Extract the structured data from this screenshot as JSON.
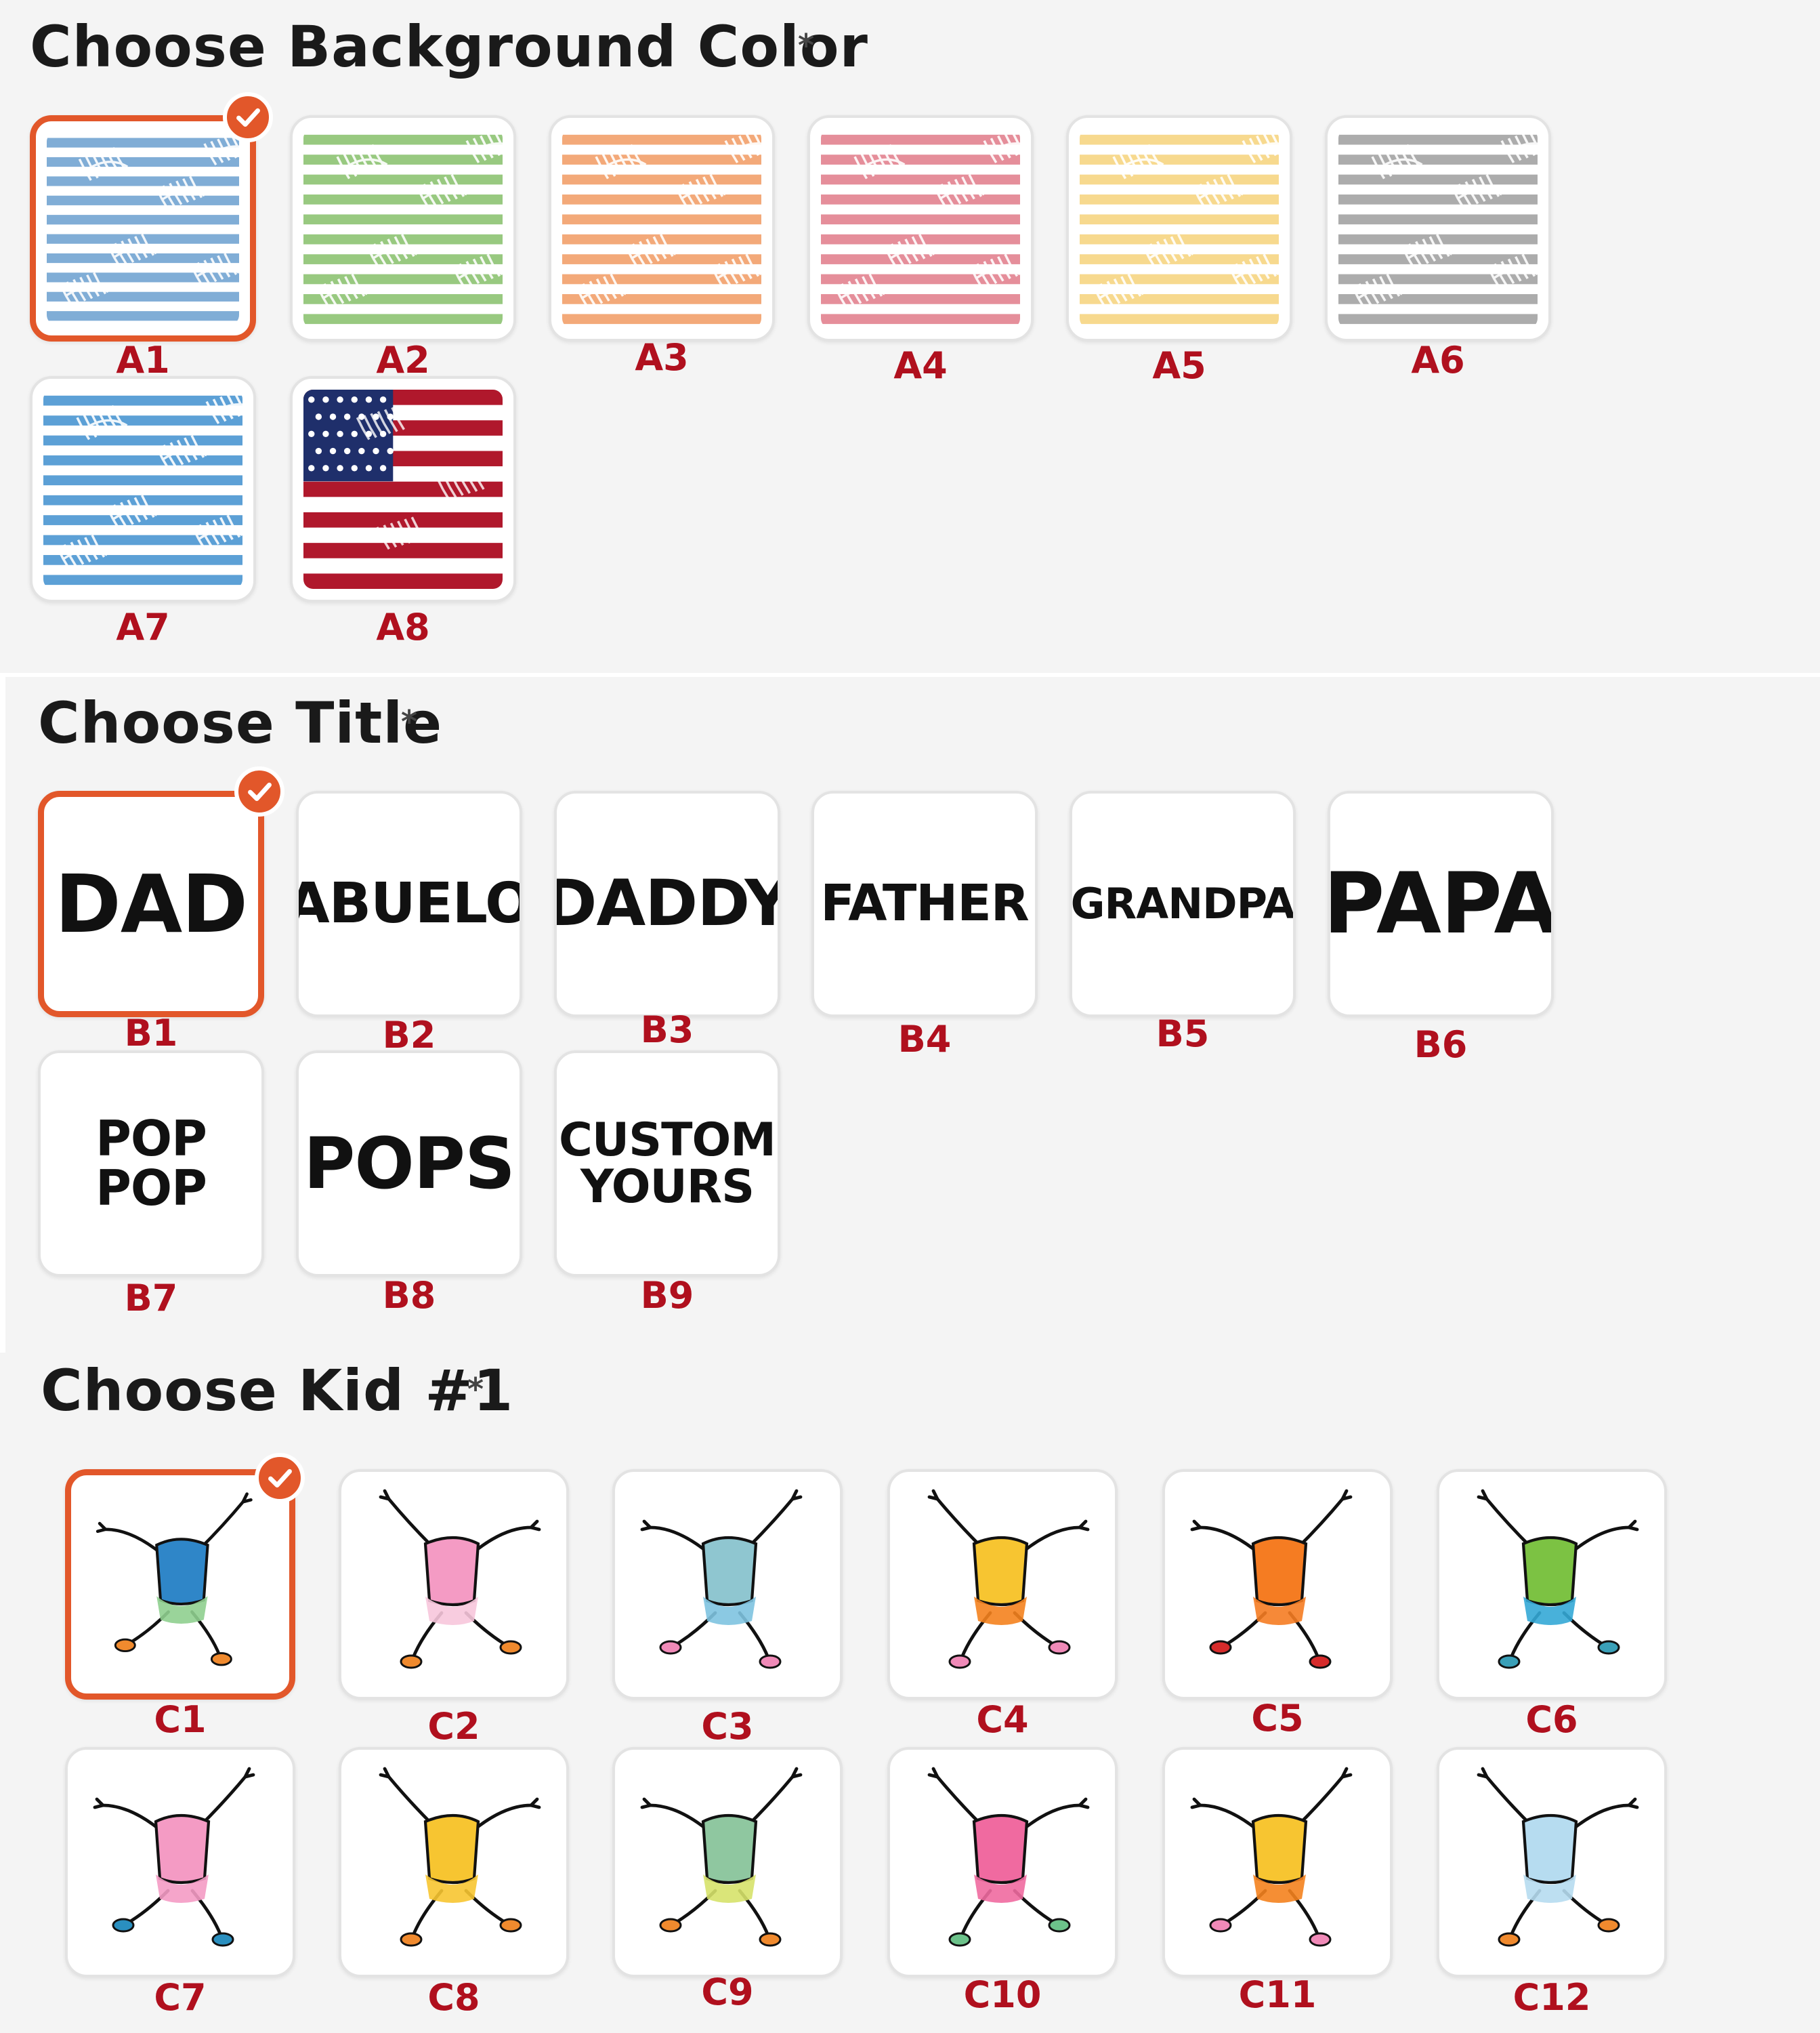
{
  "background_section": {
    "title": "Choose Background Color",
    "required_mark": "*",
    "options": [
      {
        "code": "A1",
        "stripe": "#6a9fcf",
        "selected": true
      },
      {
        "code": "A2",
        "stripe": "#86c06a",
        "selected": false
      },
      {
        "code": "A3",
        "stripe": "#f19a62",
        "selected": false
      },
      {
        "code": "A4",
        "stripe": "#e07a88",
        "selected": false
      },
      {
        "code": "A5",
        "stripe": "#f6d27a",
        "selected": false
      },
      {
        "code": "A6",
        "stripe": "#9e9e9e",
        "selected": false
      },
      {
        "code": "A7",
        "stripe": "#3f8fcf",
        "selected": false
      },
      {
        "code": "A8",
        "stripe": "american-flag",
        "selected": false
      }
    ]
  },
  "title_section": {
    "title": "Choose Title",
    "required_mark": "*",
    "options": [
      {
        "code": "B1",
        "text": "DAD",
        "selected": true
      },
      {
        "code": "B2",
        "text": "ABUELO",
        "selected": false
      },
      {
        "code": "B3",
        "text": "DADDY",
        "selected": false
      },
      {
        "code": "B4",
        "text": "FATHER",
        "selected": false
      },
      {
        "code": "B5",
        "text": "GRANDPA",
        "selected": false
      },
      {
        "code": "B6",
        "text": "PAPA",
        "selected": false
      },
      {
        "code": "B7",
        "text": "POP POP",
        "selected": false
      },
      {
        "code": "B8",
        "text": "POPS",
        "selected": false
      },
      {
        "code": "B9",
        "text": "CUSTOM\nYOURS",
        "selected": false
      }
    ]
  },
  "kid_section": {
    "title": "Choose Kid #1",
    "required_mark": "*",
    "options": [
      {
        "code": "C1",
        "shirt": "#2f86c8",
        "pants": "#8fcf8f",
        "shoe": "#f08a2e",
        "selected": true
      },
      {
        "code": "C2",
        "shirt": "#f49bc4",
        "pants": "#f7c6dc",
        "shoe": "#f08a2e",
        "selected": false
      },
      {
        "code": "C3",
        "shirt": "#8fc6d0",
        "pants": "#7ec3e0",
        "shoe": "#f08ab8",
        "selected": false
      },
      {
        "code": "C4",
        "shirt": "#f7c531",
        "pants": "#f4821e",
        "shoe": "#f08ab8",
        "selected": false
      },
      {
        "code": "C5",
        "shirt": "#f57c22",
        "pants": "#f57c22",
        "shoe": "#d62b2b",
        "selected": false
      },
      {
        "code": "C6",
        "shirt": "#7cc243",
        "pants": "#34a8d6",
        "shoe": "#3aa0b8",
        "selected": false
      },
      {
        "code": "C7",
        "shirt": "#f49bc4",
        "pants": "#f49bc4",
        "shoe": "#2a8fbf",
        "selected": false
      },
      {
        "code": "C8",
        "shirt": "#f7c531",
        "pants": "#f7c531",
        "shoe": "#f08a2e",
        "selected": false
      },
      {
        "code": "C9",
        "shirt": "#8fc7a0",
        "pants": "#d6e26a",
        "shoe": "#f08a2e",
        "selected": false
      },
      {
        "code": "C10",
        "shirt": "#f06aa0",
        "pants": "#f06aa0",
        "shoe": "#6cc28a",
        "selected": false
      },
      {
        "code": "C11",
        "shirt": "#f7c531",
        "pants": "#f4821e",
        "shoe": "#f08ab8",
        "selected": false
      },
      {
        "code": "C12",
        "shirt": "#b6dcf0",
        "pants": "#b6dcf0",
        "shoe": "#f08a2e",
        "selected": false
      }
    ]
  }
}
